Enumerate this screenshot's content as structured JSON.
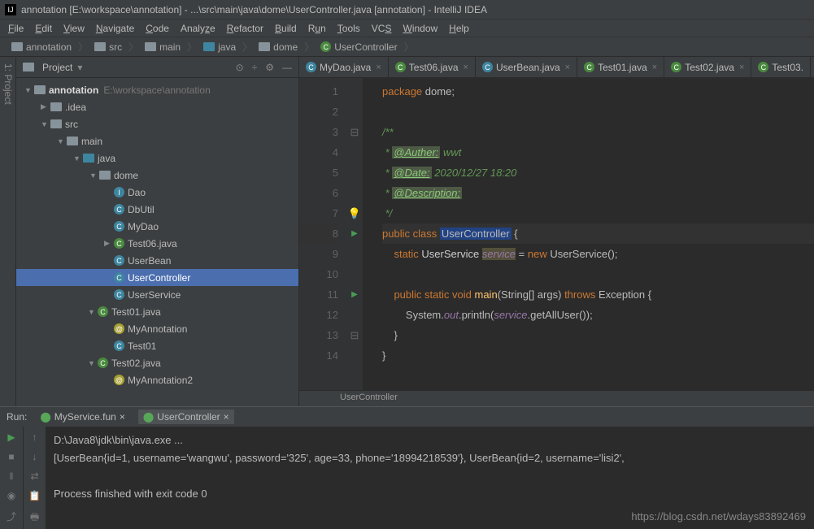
{
  "title": "annotation [E:\\workspace\\annotation] - ...\\src\\main\\java\\dome\\UserController.java [annotation] - IntelliJ IDEA",
  "menu": [
    "File",
    "Edit",
    "View",
    "Navigate",
    "Code",
    "Analyze",
    "Refactor",
    "Build",
    "Run",
    "Tools",
    "VCS",
    "Window",
    "Help"
  ],
  "breadcrumbs": [
    "annotation",
    "src",
    "main",
    "java",
    "dome",
    "UserController"
  ],
  "projectPanel": {
    "label": "Project",
    "sideTab": "1: Project"
  },
  "toolbarIcons": {
    "target": "⊙",
    "split": "÷",
    "gear": "⚙",
    "hide": "—"
  },
  "tree": {
    "root": {
      "name": "annotation",
      "path": "E:\\workspace\\annotation"
    },
    "nodes": [
      ".idea",
      "src",
      "main",
      "java",
      "dome",
      "Dao",
      "DbUtil",
      "MyDao",
      "Test06.java",
      "UserBean",
      "UserController",
      "UserService",
      "Test01.java",
      "MyAnnotation",
      "Test01",
      "Test02.java",
      "MyAnnotation2"
    ]
  },
  "tabs": [
    "MyDao.java",
    "Test06.java",
    "UserBean.java",
    "Test01.java",
    "Test02.java",
    "Test03."
  ],
  "code": {
    "pkg_kw": "package",
    "pkg": "dome",
    "c1": "/**",
    "c2": " * ",
    "auth_tag": "@Auther:",
    "auth": " wwt",
    "date_tag": "@Date:",
    "date": " 2020/12/27 18:20",
    "desc_tag": "@Description:",
    "c3": " */",
    "pub": "public",
    "cls": "class",
    "clsname": "UserController",
    "ob": "{",
    "stat": "static",
    "svc": "UserService",
    "fld": "service",
    "eq": " = ",
    "new": "new",
    "call": "UserService()",
    "semi": ";",
    "void": "void",
    "main": "main",
    "args": "(String[] args)",
    "throws": "throws",
    "exc": "Exception",
    "sys": "System.",
    "out": "out",
    "println": ".println(",
    "svc2": "service",
    "getall": ".getAllUser())",
    "cb": "}"
  },
  "crumbBottom": "UserController",
  "run": {
    "label": "Run:",
    "tabs": [
      "MyService.fun",
      "UserController"
    ],
    "line1": "D:\\Java8\\jdk\\bin\\java.exe ...",
    "line2": "[UserBean{id=1, username='wangwu', password='325', age=33, phone='18994218539'}, UserBean{id=2, username='lisi2',",
    "line3": "Process finished with exit code 0"
  },
  "watermark": "https://blog.csdn.net/wdays83892469"
}
